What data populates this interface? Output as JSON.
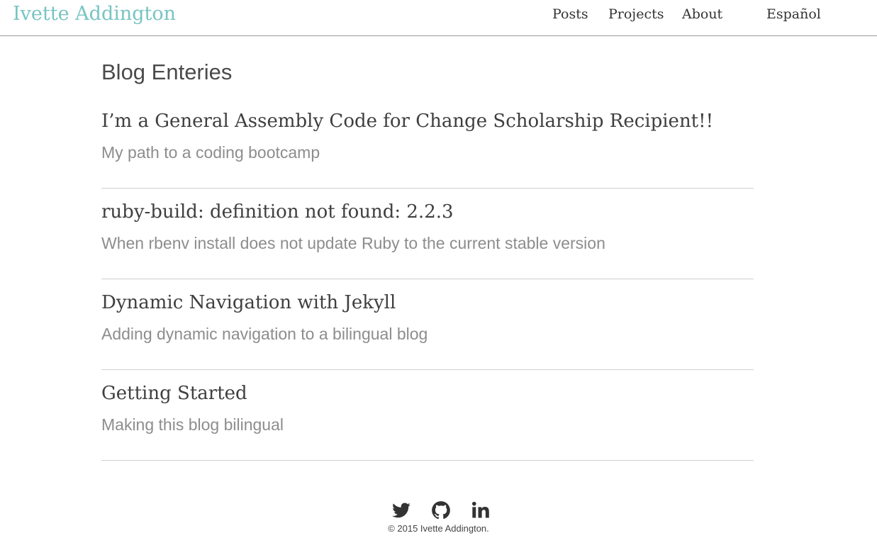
{
  "header": {
    "brand": "Ivette Addington",
    "nav": [
      {
        "label": "Posts"
      },
      {
        "label": "Projects"
      },
      {
        "label": "About"
      },
      {
        "label": "Español"
      }
    ]
  },
  "main": {
    "heading": "Blog Enteries",
    "posts": [
      {
        "title": "I’m a General Assembly Code for Change Scholarship Recipient!!",
        "subtitle": "My path to a coding bootcamp"
      },
      {
        "title": "ruby-build: definition not found: 2.2.3",
        "subtitle": "When rbenv install does not update Ruby to the current stable version"
      },
      {
        "title": "Dynamic Navigation with Jekyll",
        "subtitle": "Adding dynamic navigation to a bilingual blog"
      },
      {
        "title": "Getting Started",
        "subtitle": "Making this blog bilingual"
      }
    ]
  },
  "footer": {
    "social": [
      {
        "icon": "twitter-icon"
      },
      {
        "icon": "github-icon"
      },
      {
        "icon": "linkedin-icon"
      }
    ],
    "copyright": "© 2015 Ivette Addington."
  },
  "colors": {
    "brand": "#78c4c2",
    "text": "#3f3f3f",
    "subtitle": "#8d8d8d",
    "divider": "#cfcfcf"
  }
}
